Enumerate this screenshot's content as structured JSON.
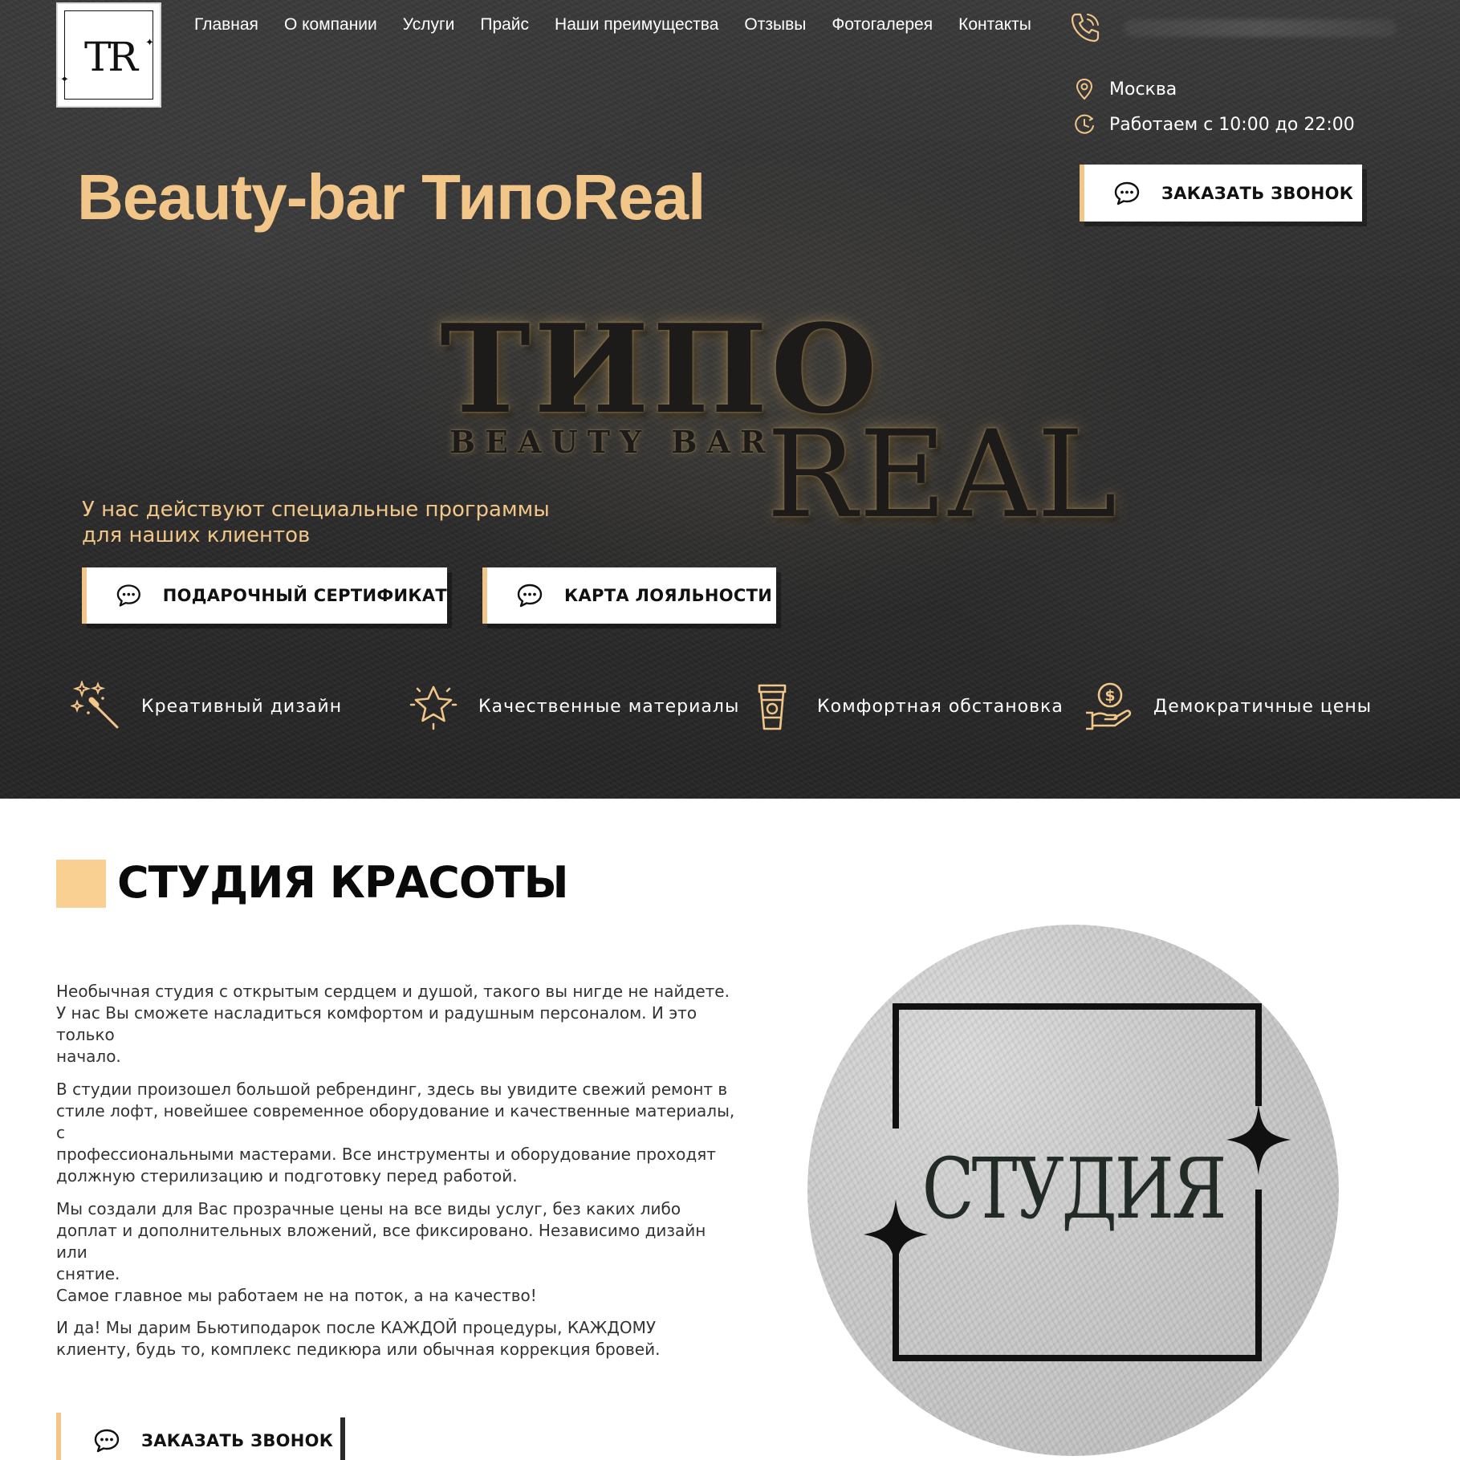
{
  "logo": {
    "text": "TR"
  },
  "nav": [
    {
      "label": "Главная"
    },
    {
      "label": "О компании"
    },
    {
      "label": "Услуги"
    },
    {
      "label": "Прайс"
    },
    {
      "label": "Наши преимущества"
    },
    {
      "label": "Отзывы"
    },
    {
      "label": "Фотогалерея"
    },
    {
      "label": "Контакты"
    }
  ],
  "contacts": {
    "city": "Москва",
    "hours": "Работаем с 10:00 до 22:00",
    "call_button": "ЗАКАЗАТЬ ЗВОНОК"
  },
  "hero": {
    "title": "Beauty-bar ТипоReal",
    "sign_top": "ТИПО",
    "sign_sub": "BEAUTY BAR",
    "sign_bottom": "REAL",
    "subtitle_line1": "У нас действуют специальные программы",
    "subtitle_line2": "для наших клиентов",
    "gift_button": "ПОДАРОЧНЫЙ СЕРТИФИКАТ",
    "loyalty_button": "КАРТА ЛОЯЛЬНОСТИ"
  },
  "features": [
    {
      "label": "Креативный дизайн",
      "icon": "magic-wand-icon"
    },
    {
      "label": "Качественные материалы",
      "icon": "star-icon"
    },
    {
      "label": "Комфортная обстановка",
      "icon": "coffee-cup-icon"
    },
    {
      "label": "Демократичные цены",
      "icon": "hand-coin-icon"
    }
  ],
  "studio": {
    "title": "СТУДИЯ КРАСОТЫ",
    "p1_l1": "Необычная студия с открытым сердцем и душой, такого вы нигде не найдете.",
    "p1_l2": "У нас Вы сможете насладиться комфортом и радушным персоналом. И это только",
    "p1_l3": "начало.",
    "p2_l1": "В студии произошел большой ребрендинг, здесь вы увидите свежий ремонт в",
    "p2_l2": "стиле лофт, новейшее современное оборудование и качественные материалы, с",
    "p2_l3": "профессиональными мастерами. Все инструменты и оборудование проходят",
    "p2_l4": "должную стерилизацию и подготовку перед работой.",
    "p3_l1": "Мы создали для Вас прозрачные цены на все виды услуг, без каких либо",
    "p3_l2": "доплат и дополнительных вложений, все фиксировано. Независимо дизайн или",
    "p3_l3": "снятие.",
    "p3_l4": "Самое главное мы работаем не на поток, а на качество!",
    "p4_l1": "И да! Мы дарим Бьютиподарок после КАЖДОЙ процедуры, КАЖДОМУ",
    "p4_l2": "клиенту, будь то, комплекс педикюра или обычная коррекция бровей.",
    "call_button": "ЗАКАЗАТЬ ЗВОНОК",
    "image_text": "СТУДИЯ"
  },
  "colors": {
    "accent": "#f2c689",
    "accent_square": "#f9cf92",
    "hero_bg": "#2e2e2e"
  }
}
